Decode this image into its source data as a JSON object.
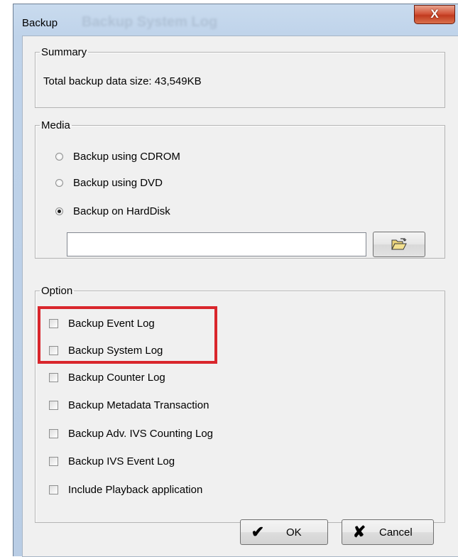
{
  "window": {
    "title": "Backup",
    "background_title": "Backup System Log",
    "close_label": "X"
  },
  "summary": {
    "legend": "Summary",
    "total_text": "Total backup data size: 43,549KB"
  },
  "media": {
    "legend": "Media",
    "options": [
      {
        "label": "Backup using CDROM",
        "selected": false
      },
      {
        "label": "Backup using DVD",
        "selected": false
      },
      {
        "label": "Backup on HardDisk",
        "selected": true
      }
    ],
    "path_value": "",
    "browse_icon": "folder-open-icon"
  },
  "option": {
    "legend": "Option",
    "items": [
      {
        "label": "Backup Event Log",
        "checked": false
      },
      {
        "label": "Backup System Log",
        "checked": false
      },
      {
        "label": "Backup Counter Log",
        "checked": false
      },
      {
        "label": "Backup Metadata Transaction",
        "checked": false
      },
      {
        "label": "Backup Adv. IVS Counting Log",
        "checked": false
      },
      {
        "label": "Backup IVS Event Log",
        "checked": false
      },
      {
        "label": "Include Playback application",
        "checked": false
      }
    ]
  },
  "buttons": {
    "ok_label": "OK",
    "ok_icon": "checkmark-icon",
    "cancel_label": "Cancel",
    "cancel_icon": "x-icon"
  },
  "colors": {
    "highlight": "#d9262c",
    "close_button": "#c13a1f"
  }
}
